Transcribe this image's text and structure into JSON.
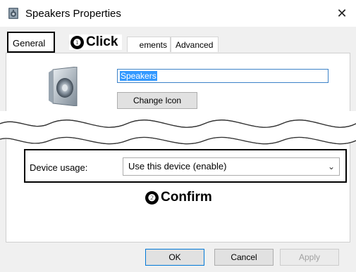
{
  "window": {
    "title": "Speakers Properties",
    "close_glyph": "✕"
  },
  "tabs": [
    {
      "label": "General"
    },
    {
      "label": "ements"
    },
    {
      "label": "Advanced"
    }
  ],
  "annotations": {
    "click_num": "❶",
    "click_label": "Click",
    "confirm_num": "❷",
    "confirm_label": "Confirm"
  },
  "general": {
    "icon": "speaker-icon",
    "device_name": "Speakers",
    "change_icon_label": "Change Icon",
    "device_usage_label": "Device usage:",
    "device_usage_value": "Use this device (enable)"
  },
  "buttons": {
    "ok": "OK",
    "cancel": "Cancel",
    "apply": "Apply"
  },
  "colors": {
    "selection": "#3399ff",
    "focus_border": "#0078d7"
  }
}
